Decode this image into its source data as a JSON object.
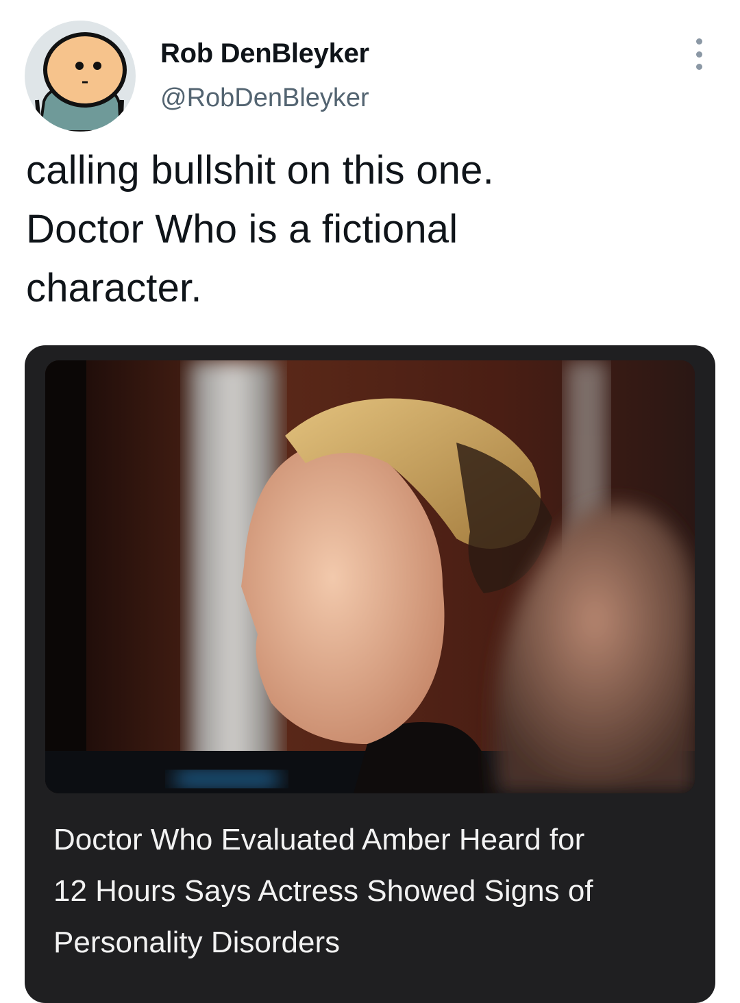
{
  "tweet": {
    "author": {
      "display_name": "Rob DenBleyker",
      "handle": "@RobDenBleyker",
      "avatar_icon": "cartoon-character-avatar"
    },
    "more_icon": "vertical-ellipsis-icon",
    "text_lines": [
      "calling bullshit on this one.",
      "Doctor Who is a fictional",
      "character."
    ],
    "link_card": {
      "image_icon": "courtroom-photo",
      "title_lines": [
        "Doctor Who Evaluated Amber Heard for",
        "12 Hours Says Actress Showed Signs of",
        "Personality Disorders"
      ]
    }
  },
  "colors": {
    "text_primary": "#0f1419",
    "text_secondary": "#536471",
    "card_background": "#1f1f21",
    "card_text": "#f2f2f2"
  }
}
